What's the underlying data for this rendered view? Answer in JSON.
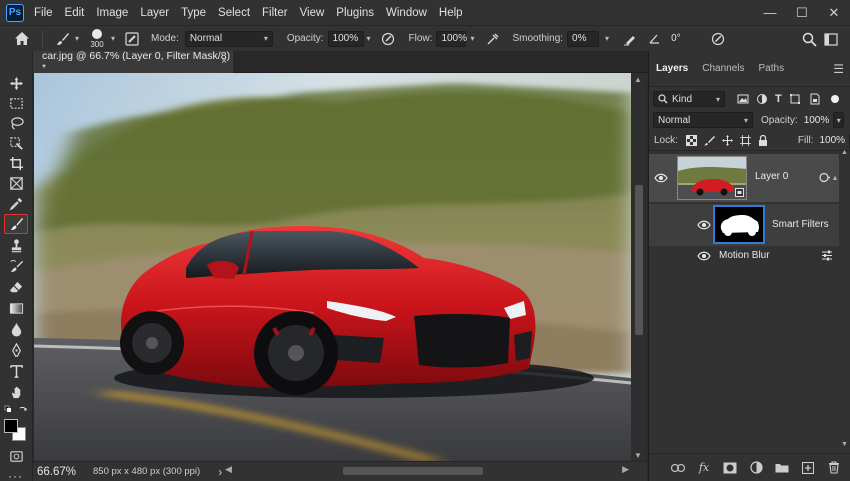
{
  "app": {
    "logo_text": "Ps"
  },
  "menu": [
    "File",
    "Edit",
    "Image",
    "Layer",
    "Type",
    "Select",
    "Filter",
    "View",
    "Plugins",
    "Window",
    "Help"
  ],
  "window_controls": {
    "minimize": "—",
    "restore": "☐",
    "close": "✕"
  },
  "options": {
    "brush_size": "300",
    "mode_label": "Mode:",
    "mode_value": "Normal",
    "opacity_label": "Opacity:",
    "opacity_value": "100%",
    "flow_label": "Flow:",
    "flow_value": "100%",
    "smoothing_label": "Smoothing:",
    "smoothing_value": "0%",
    "angle_value": "0°"
  },
  "document": {
    "tab_title": "car.jpg @ 66.7% (Layer 0, Filter Mask/8) *",
    "tab_close": "×",
    "zoom": "66.67%",
    "info": "850 px x 480 px (300 ppi)",
    "info_arrow": "›"
  },
  "panel": {
    "tabs": [
      "Layers",
      "Channels",
      "Paths"
    ],
    "filter_kind": "Kind",
    "blend_mode": "Normal",
    "opacity_label": "Opacity:",
    "opacity_value": "100%",
    "lock_label": "Lock:",
    "fill_label": "Fill:",
    "fill_value": "100%",
    "layers": [
      {
        "name": "Layer 0"
      },
      {
        "name": "Smart Filters"
      },
      {
        "name": "Motion Blur"
      }
    ]
  },
  "colors": {
    "accent_active_tool": "#e1322e",
    "mask_selection": "#2f7bd6",
    "ps_blue": "#4fa3ff"
  },
  "icons": [
    "home-icon",
    "brush-icon",
    "brush-settings-icon",
    "airbrush-icon",
    "eraser-icon",
    "angle-icon",
    "pressure-icon",
    "search-icon",
    "workspace-icon",
    "share-icon",
    "eye-icon",
    "link-icon",
    "fx-icon",
    "mask-icon",
    "adjustment-icon",
    "group-icon",
    "new-layer-icon",
    "trash-icon"
  ]
}
